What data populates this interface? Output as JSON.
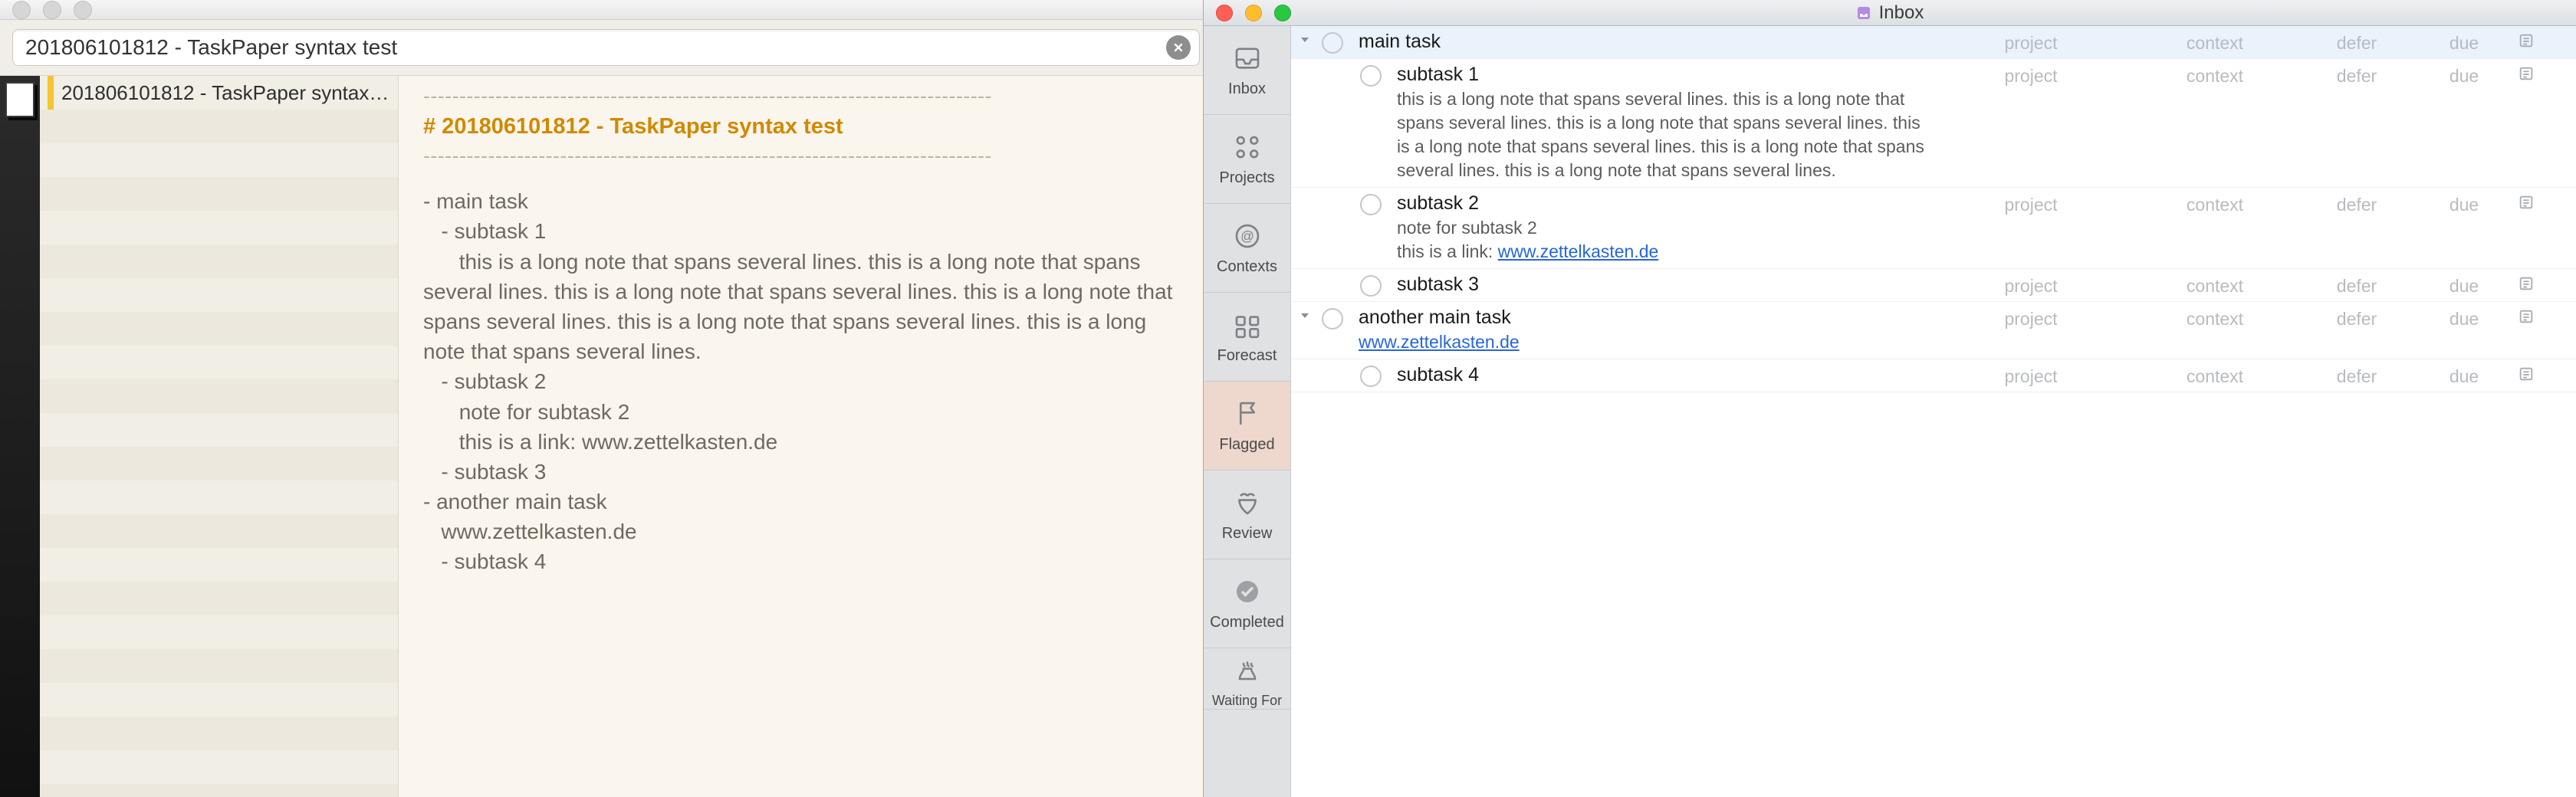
{
  "left": {
    "search_value": "201806101812 - TaskPaper syntax test",
    "file_list_item": "201806101812 - TaskPaper syntax…",
    "dashes": "-------------------------------------------------------------------------------",
    "h1": "# 201806101812 - TaskPaper syntax test",
    "body": "- main task\n   - subtask 1\n      this is a long note that spans several lines. this is a long note that spans several lines. this is a long note that spans several lines. this is a long note that spans several lines. this is a long note that spans several lines. this is a long note that spans several lines.\n   - subtask 2\n      note for subtask 2\n      this is a link: www.zettelkasten.de\n   - subtask 3\n- another main task\n   www.zettelkasten.de\n   - subtask 4"
  },
  "right": {
    "window_title": "Inbox",
    "sidebar": {
      "items": [
        {
          "label": "Inbox"
        },
        {
          "label": "Projects"
        },
        {
          "label": "Contexts"
        },
        {
          "label": "Forecast"
        },
        {
          "label": "Flagged"
        },
        {
          "label": "Review"
        },
        {
          "label": "Completed"
        },
        {
          "label": "Waiting For"
        }
      ]
    },
    "columns": {
      "project": "project",
      "context": "context",
      "defer": "defer",
      "due": "due"
    },
    "tasks": [
      {
        "title": "main task",
        "level": 0,
        "expandable": true,
        "note_html": ""
      },
      {
        "title": "subtask 1",
        "level": 1,
        "note_html": "this is a long note that spans several lines. this is a long note that spans several lines. this is a long note that spans several lines. this is a long note that spans several lines. this is a long note that spans several lines. this is a long note that spans several lines."
      },
      {
        "title": "subtask 2",
        "level": 1,
        "note_html": "note for subtask 2<br>this is a link: <a href='#'>www.zettelkasten.de</a>"
      },
      {
        "title": "subtask 3",
        "level": 1,
        "note_html": ""
      },
      {
        "title": "another main task",
        "level": 0,
        "expandable": true,
        "note_html": "<a href='#'>www.zettelkasten.de</a>"
      },
      {
        "title": "subtask 4",
        "level": 1,
        "note_html": ""
      }
    ]
  }
}
